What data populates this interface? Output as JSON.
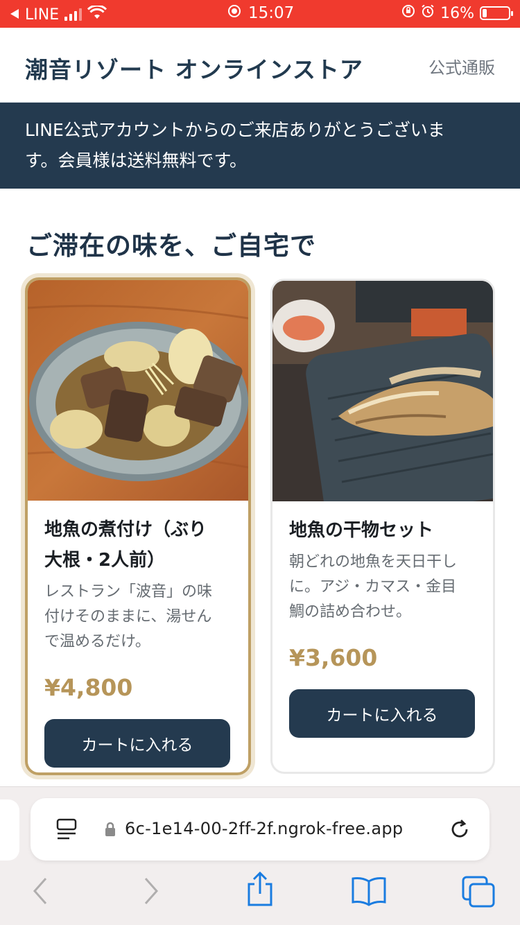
{
  "status_bar": {
    "back_label": "LINE",
    "time": "15:07",
    "battery_percent": "16%",
    "battery_level": 0.16
  },
  "header": {
    "title": "潮音リゾート オンラインストア",
    "link": "公式通販"
  },
  "banner": {
    "line1": "LINE公式アカウントからのご来店ありがとうございま",
    "line2": "す。会員様は送料無料です。"
  },
  "section": {
    "title": "ご滞在の味を、ご自宅で"
  },
  "products": [
    {
      "name_line1": "地魚の煮付け（ぶり",
      "name_line2": "大根・2人前）",
      "desc_line1": "レストラン「波音」の味",
      "desc_line2": "付けそのままに、湯せん",
      "desc_line3": "で温めるだけ。",
      "price": "¥4,800",
      "button": "カートに入れる"
    },
    {
      "name_line1": "地魚の干物セット",
      "desc_line1": "朝どれの地魚を天日干し",
      "desc_line2": "に。アジ・カマス・金目",
      "desc_line3": "鯛の詰め合わせ。",
      "price": "¥3,600",
      "button": "カートに入れる"
    }
  ],
  "browser": {
    "url": "6c-1e14-00-2ff-2f.ngrok-free.app"
  },
  "icons": {
    "reader": "reader-icon",
    "lock": "lock-icon",
    "reload": "reload-icon",
    "back": "back-icon",
    "forward": "forward-icon",
    "share": "share-icon",
    "bookmarks": "bookmarks-icon",
    "tabs": "tabs-icon"
  },
  "colors": {
    "status_bar": "#f03a2e",
    "brand_navy": "#243a4f",
    "price_gold": "#b69559",
    "accent_blue": "#1a7ce0"
  }
}
